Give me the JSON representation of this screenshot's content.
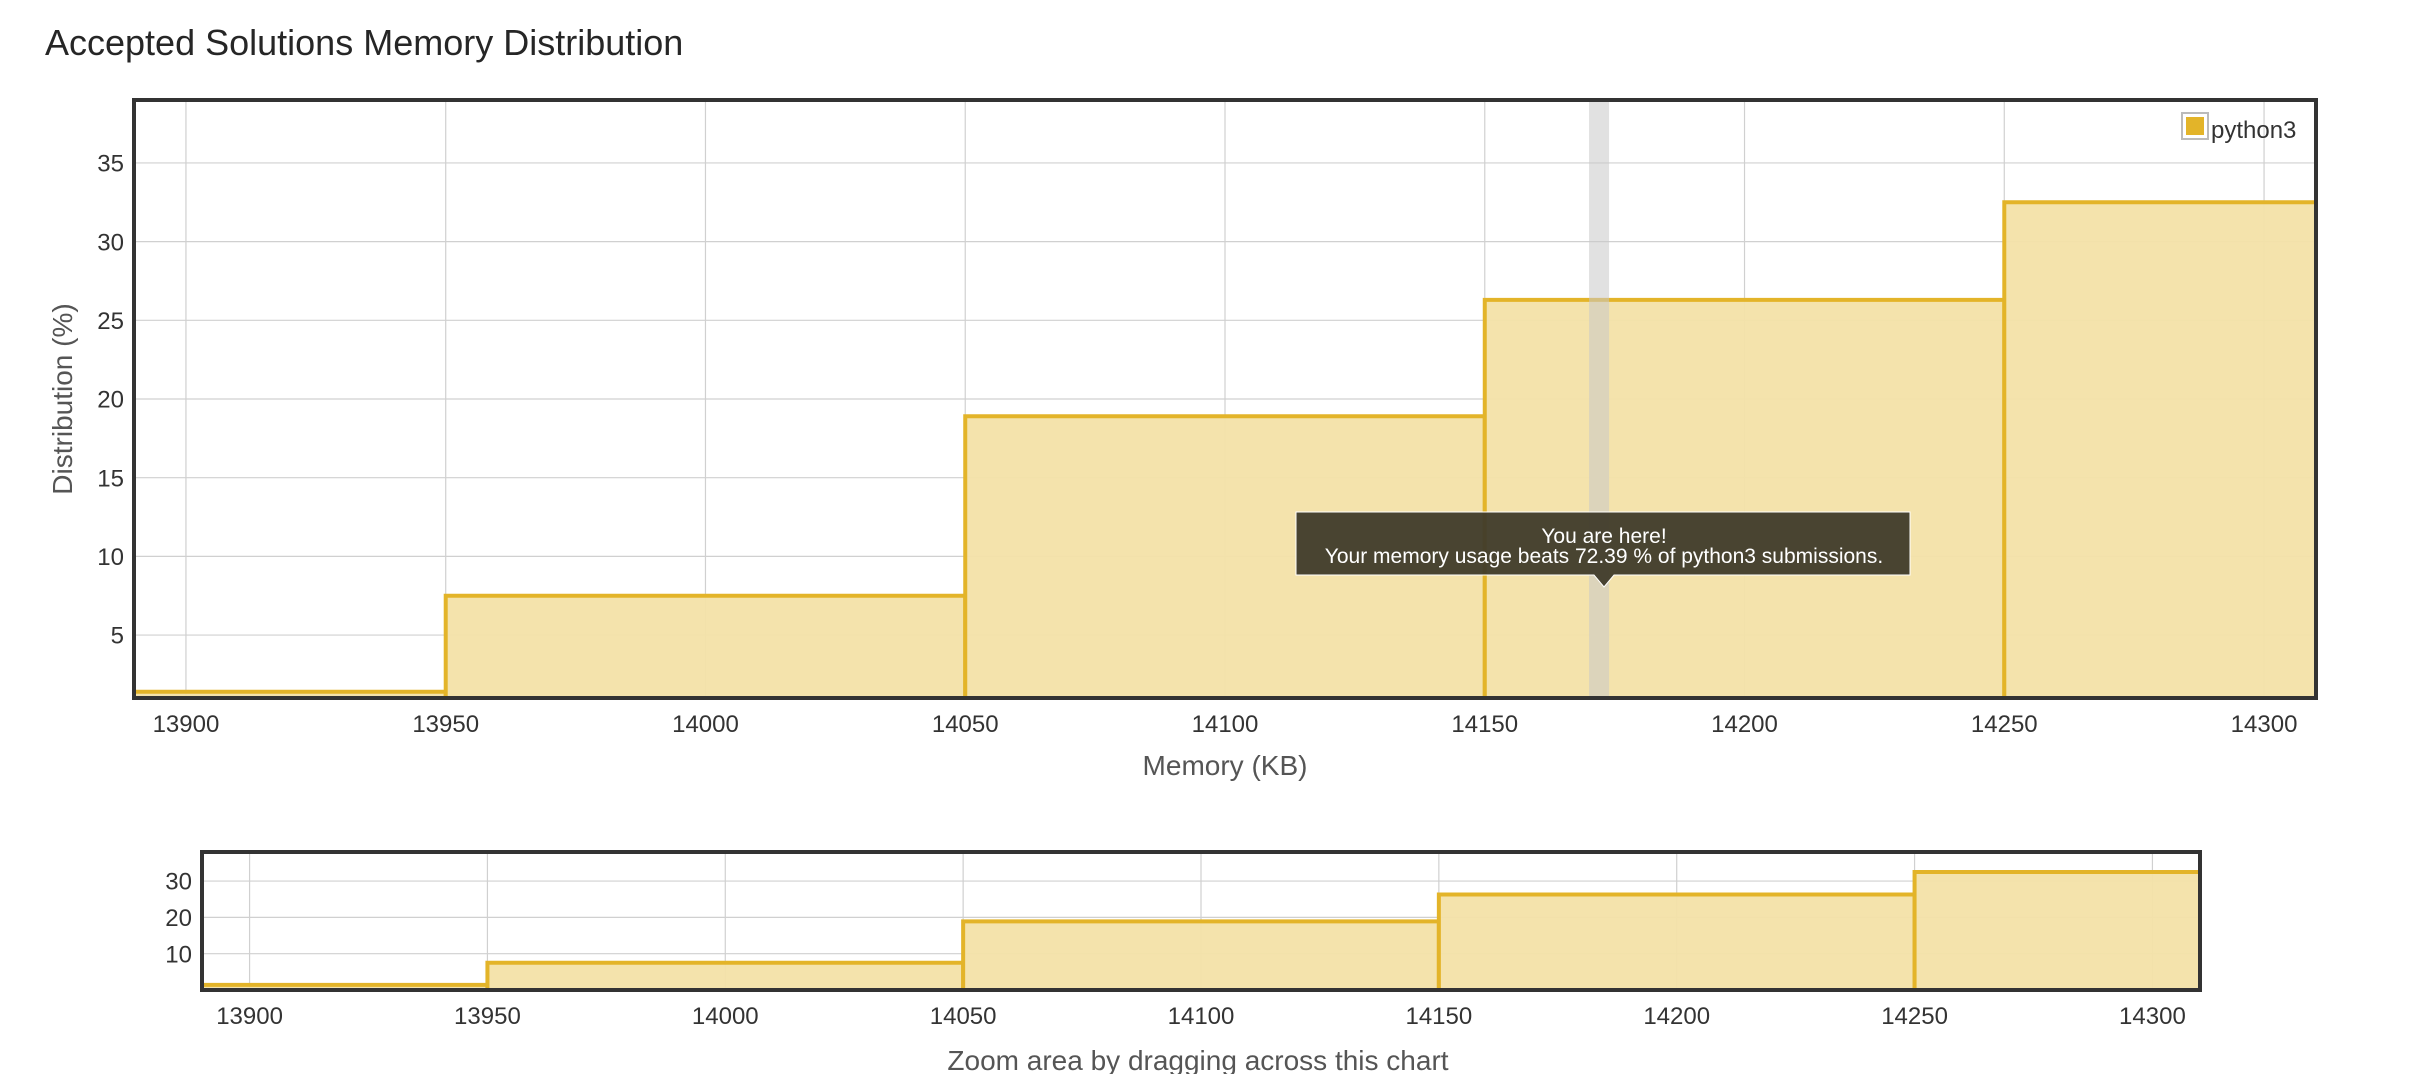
{
  "page": {
    "title": "Accepted Solutions Memory Distribution"
  },
  "legend": {
    "label": "python3"
  },
  "tooltip": {
    "line1": "You are here!",
    "line2": "Your memory usage beats 72.39 % of python3 submissions."
  },
  "zoom": {
    "caption": "Zoom area by dragging across this chart"
  },
  "colors": {
    "bar_fill": "#f3e1a8",
    "bar_stroke": "#e3b429",
    "legend_swatch": "#e3b429",
    "highlight": "#c8c8c8",
    "tooltip_bg": "#3f3b2a",
    "grid": "#d0d0d0",
    "frame": "#333333"
  },
  "chart_data": [
    {
      "type": "bar",
      "role": "main",
      "xlabel": "Memory (KB)",
      "ylabel": "Distribution (%)",
      "xlim": [
        13890,
        14310
      ],
      "ylim": [
        1,
        39
      ],
      "xticks": [
        13900,
        13950,
        14000,
        14050,
        14100,
        14150,
        14200,
        14250,
        14300
      ],
      "yticks": [
        5,
        10,
        15,
        20,
        25,
        30,
        35
      ],
      "grid": true,
      "legend_position": "top-right",
      "series": [
        {
          "name": "python3",
          "bins": [
            {
              "from": 13850,
              "to": 13950,
              "value": 1.4
            },
            {
              "from": 13950,
              "to": 14050,
              "value": 7.5
            },
            {
              "from": 14050,
              "to": 14150,
              "value": 18.9
            },
            {
              "from": 14150,
              "to": 14250,
              "value": 26.3
            },
            {
              "from": 14250,
              "to": 14350,
              "value": 32.5
            }
          ]
        }
      ],
      "marker_x": 14172
    },
    {
      "type": "bar",
      "role": "navigator",
      "xlim": [
        13890,
        14310
      ],
      "ylim": [
        0,
        38
      ],
      "xticks": [
        13900,
        13950,
        14000,
        14050,
        14100,
        14150,
        14200,
        14250,
        14300
      ],
      "yticks": [
        10,
        20,
        30
      ],
      "grid": true,
      "series": [
        {
          "name": "python3",
          "bins": [
            {
              "from": 13850,
              "to": 13950,
              "value": 1.4
            },
            {
              "from": 13950,
              "to": 14050,
              "value": 7.5
            },
            {
              "from": 14050,
              "to": 14150,
              "value": 18.9
            },
            {
              "from": 14150,
              "to": 14250,
              "value": 26.3
            },
            {
              "from": 14250,
              "to": 14350,
              "value": 32.5
            }
          ]
        }
      ]
    }
  ]
}
